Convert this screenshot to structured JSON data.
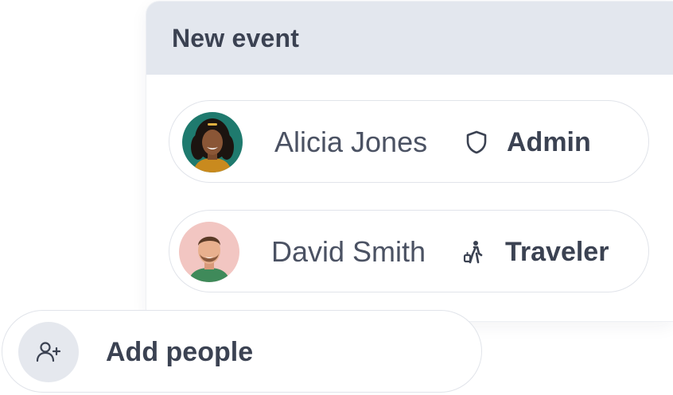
{
  "header": {
    "title": "New event"
  },
  "people": [
    {
      "name": "Alicia Jones",
      "role": "Admin",
      "role_icon": "shield-icon",
      "avatar": "avatar-alicia"
    },
    {
      "name": "David Smith",
      "role": "Traveler",
      "role_icon": "traveler-icon",
      "avatar": "avatar-david"
    }
  ],
  "add_people": {
    "label": "Add people",
    "icon": "add-person-icon"
  },
  "colors": {
    "header_bg": "#e3e7ee",
    "text_primary": "#3b4252",
    "text_secondary": "#4b5263",
    "border": "#e1e4ea"
  }
}
